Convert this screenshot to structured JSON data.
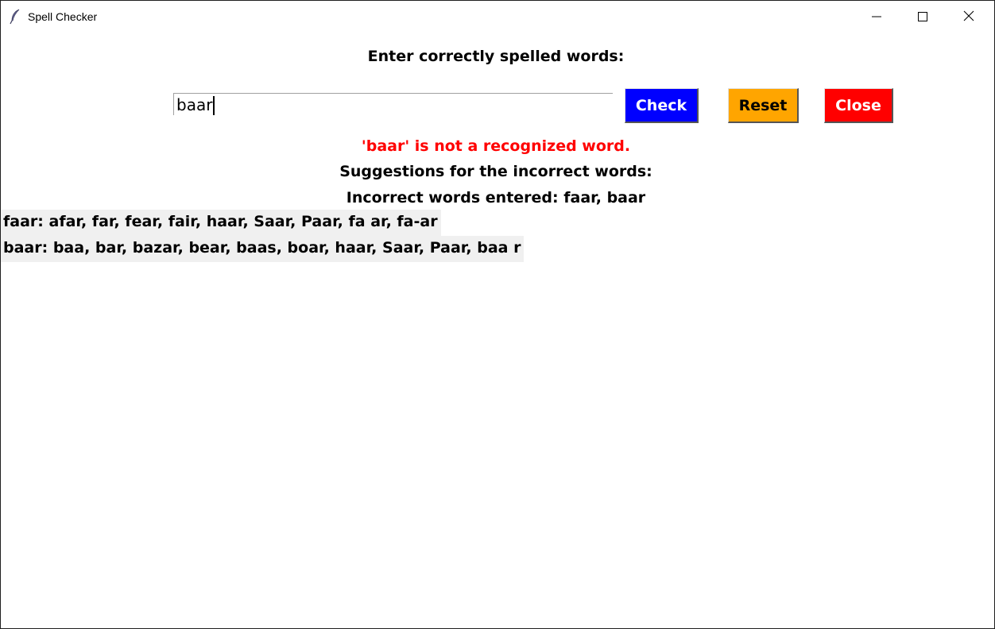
{
  "window": {
    "title": "Spell Checker",
    "app_icon": "feather-icon",
    "controls": {
      "minimize_icon": "minimize-icon",
      "maximize_icon": "maximize-icon",
      "close_icon": "close-icon"
    }
  },
  "main": {
    "prompt": "Enter correctly spelled words:",
    "entry_value": "baar",
    "buttons": {
      "check": "Check",
      "reset": "Reset",
      "close": "Close"
    },
    "button_colors": {
      "check": "#0000ff",
      "reset": "#ffa500",
      "close": "#ff0000"
    },
    "status_message": "'baar' is not a recognized word.",
    "status_color": "#ff0000",
    "suggestions_heading": "Suggestions for the incorrect words:",
    "incorrect_words_line": "Incorrect words entered: faar, baar",
    "suggestions": [
      "faar: afar, far, fear, fair, haar, Saar, Paar, fa ar, fa-ar",
      "baar: baa, bar, bazar, bear, baas, boar, haar, Saar, Paar, baa r"
    ]
  }
}
